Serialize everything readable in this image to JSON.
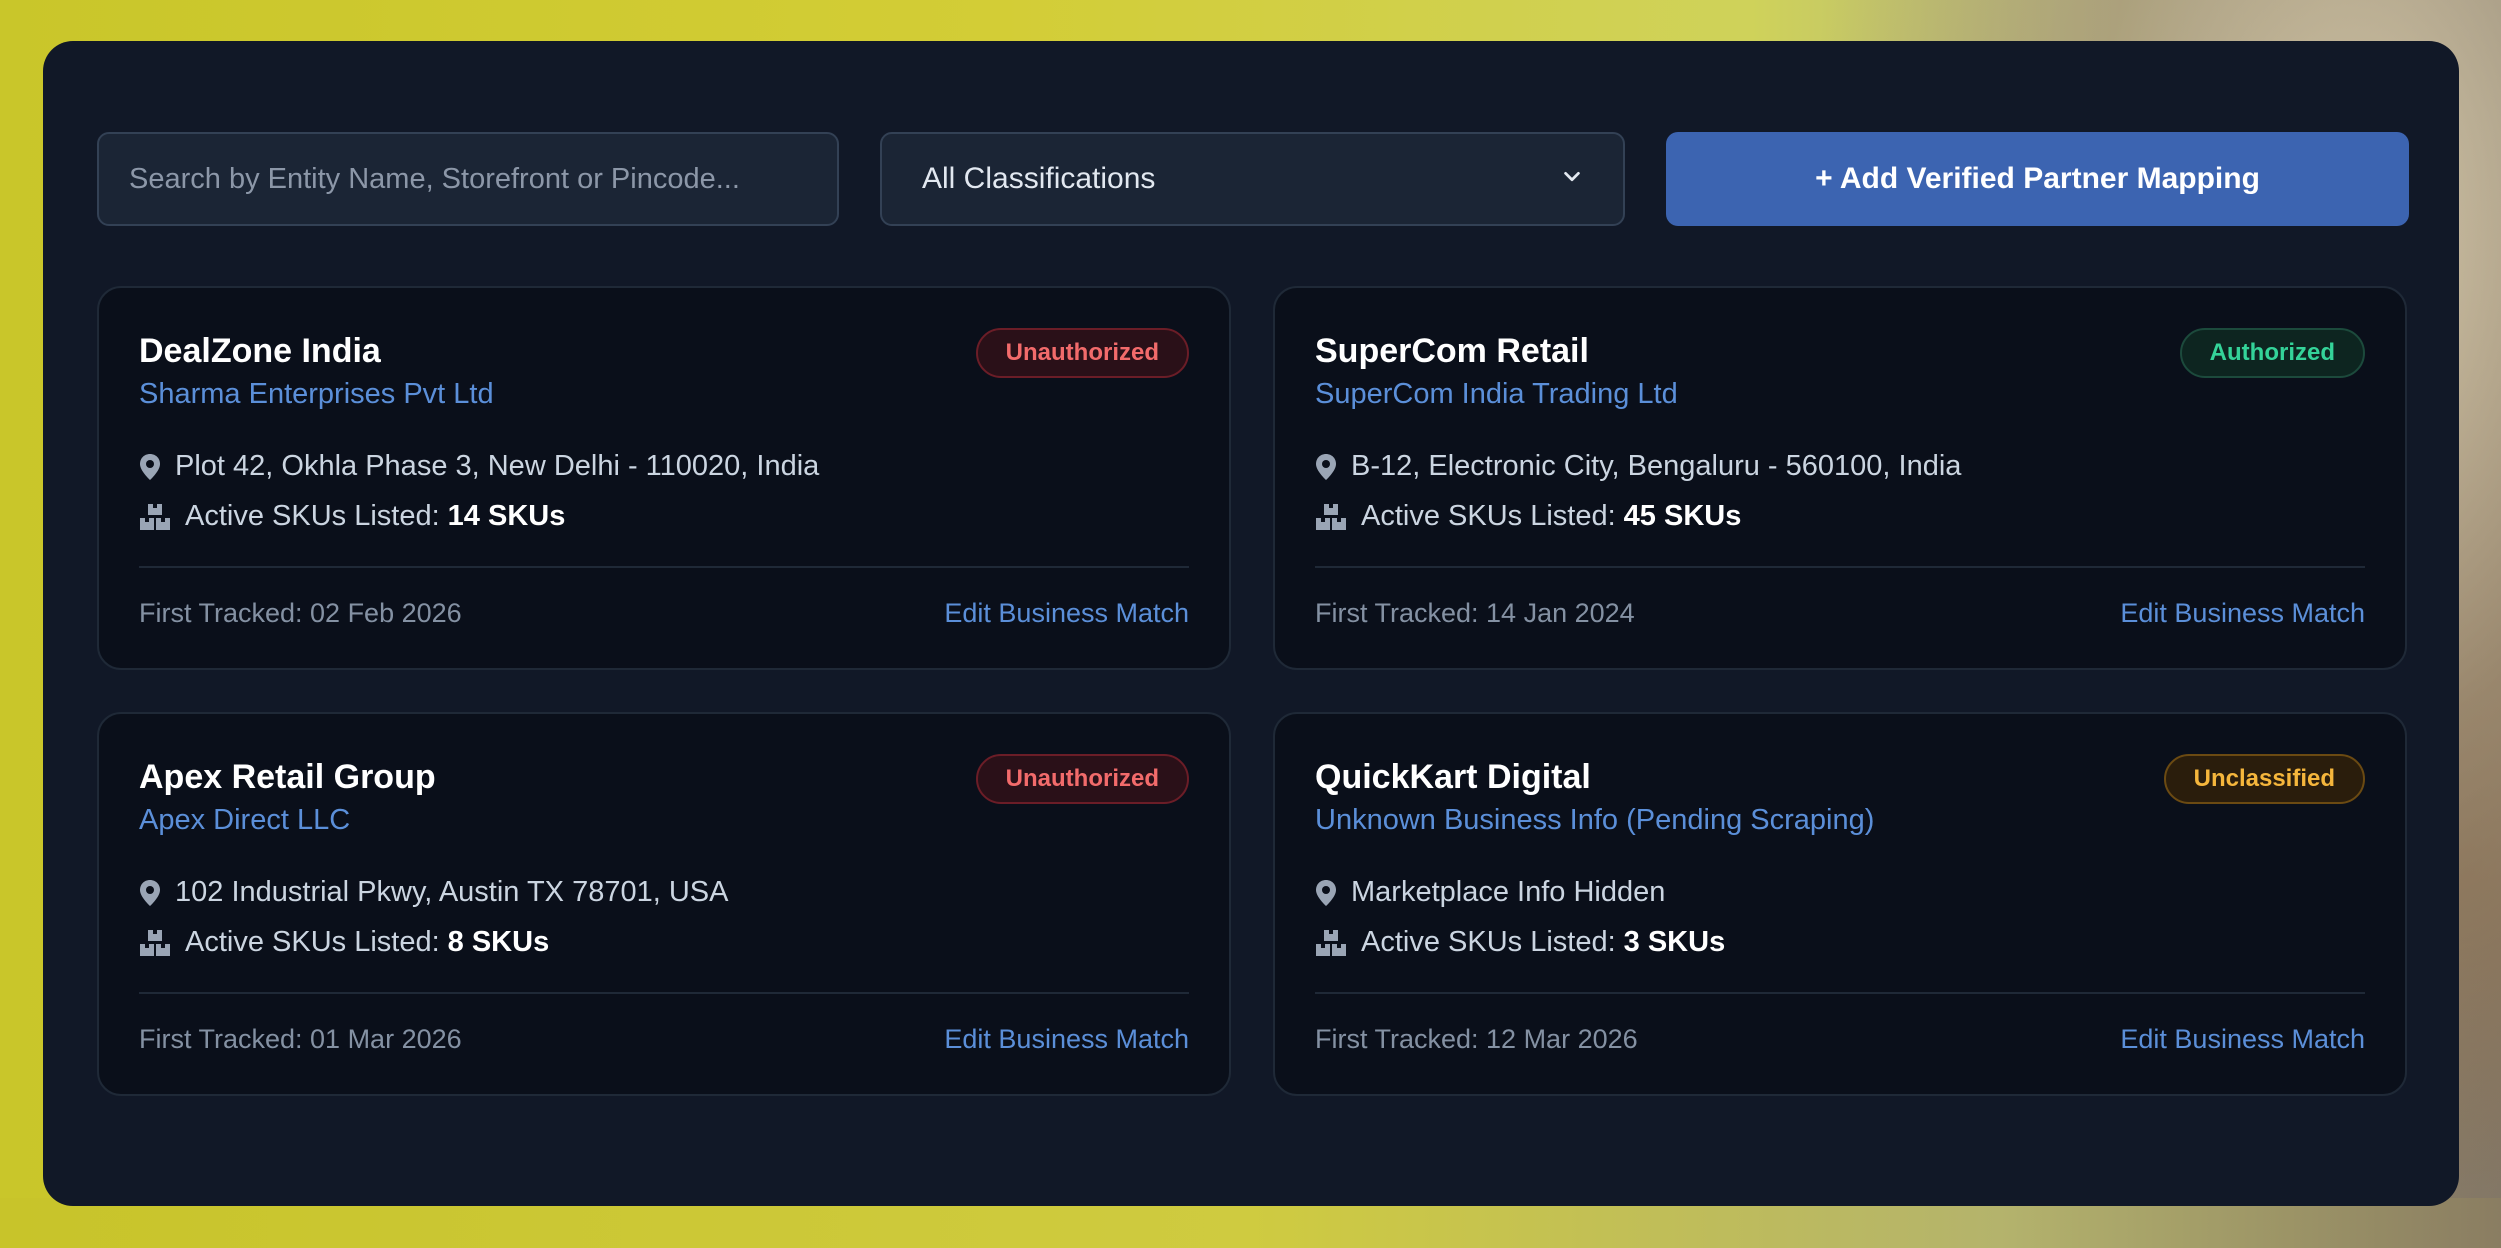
{
  "toolbar": {
    "search_placeholder": "Search by Entity Name, Storefront or Pincode...",
    "classification_selected": "All Classifications",
    "add_button_label": "+ Add Verified Partner Mapping"
  },
  "cards": [
    {
      "title": "DealZone India",
      "entity": "Sharma Enterprises Pvt Ltd",
      "status": "Unauthorized",
      "address": "Plot 42, Okhla Phase 3, New Delhi - 110020, India",
      "skus_label": "Active SKUs Listed:",
      "skus_value": "14 SKUs",
      "first_tracked": "First Tracked: 02 Feb 2026",
      "edit_label": "Edit Business Match"
    },
    {
      "title": "SuperCom Retail",
      "entity": "SuperCom India Trading Ltd",
      "status": "Authorized",
      "address": "B-12, Electronic City, Bengaluru - 560100, India",
      "skus_label": "Active SKUs Listed:",
      "skus_value": "45 SKUs",
      "first_tracked": "First Tracked: 14 Jan 2024",
      "edit_label": "Edit Business Match"
    },
    {
      "title": "Apex Retail Group",
      "entity": "Apex Direct LLC",
      "status": "Unauthorized",
      "address": "102 Industrial Pkwy, Austin TX 78701, USA",
      "skus_label": "Active SKUs Listed:",
      "skus_value": "8 SKUs",
      "first_tracked": "First Tracked: 01 Mar 2026",
      "edit_label": "Edit Business Match"
    },
    {
      "title": "QuickKart Digital",
      "entity": "Unknown Business Info (Pending Scraping)",
      "status": "Unclassified",
      "address": "Marketplace Info Hidden",
      "skus_label": "Active SKUs Listed:",
      "skus_value": "3 SKUs",
      "first_tracked": "First Tracked: 12 Mar 2026",
      "edit_label": "Edit Business Match"
    }
  ],
  "status_colors": {
    "Unauthorized": "#f26b6b",
    "Authorized": "#34d399",
    "Unclassified": "#f5b63c"
  },
  "icons": {
    "location": "map-pin-icon",
    "sku": "boxes-icon",
    "dropdown": "chevron-down-icon"
  }
}
